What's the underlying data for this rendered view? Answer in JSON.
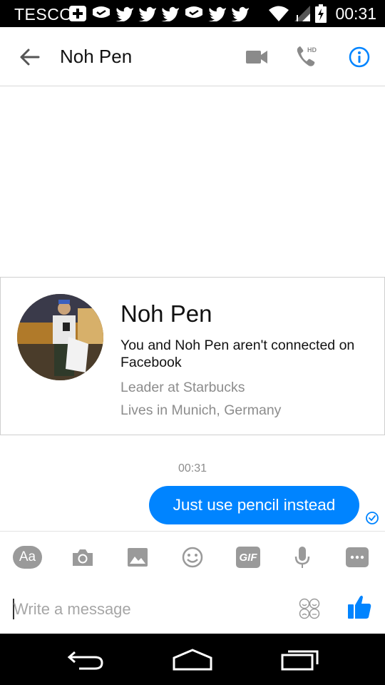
{
  "status_bar": {
    "carrier": "TESCO",
    "time": "00:31",
    "icons": [
      "plus-icon",
      "chat-bubble-icon",
      "twitter-icon",
      "twitter-icon",
      "twitter-icon",
      "chat-bubble-icon",
      "twitter-icon",
      "twitter-icon",
      "wifi-icon",
      "signal-icon",
      "battery-charging-icon"
    ]
  },
  "app_bar": {
    "title": "Noh Pen",
    "icons": [
      "back-arrow-icon",
      "video-camera-icon",
      "phone-hd-icon",
      "info-icon"
    ],
    "hd_badge": "HD",
    "accent": "#0084ff"
  },
  "profile_card": {
    "name": "Noh Pen",
    "connection": "You and Noh Pen aren't connected on Facebook",
    "job": "Leader at Starbucks",
    "location": "Lives in Munich, Germany"
  },
  "messages": {
    "timestamp": "00:31",
    "items": [
      {
        "text": "Just use pencil instead",
        "sender": "me",
        "status": "seen-check-icon"
      }
    ]
  },
  "composer": {
    "aa_label": "Aa",
    "gif_label": "GIF",
    "tools": [
      "camera-icon",
      "gallery-icon",
      "emoji-icon",
      "mic-icon",
      "more-icon"
    ],
    "input_placeholder": "Write a message",
    "input_value": "",
    "sticker_icon": "sticker-icon",
    "like_icon": "thumbs-up-icon"
  },
  "nav_bar": {
    "icons": [
      "nav-back-icon",
      "nav-home-icon",
      "nav-recent-apps-icon"
    ]
  }
}
